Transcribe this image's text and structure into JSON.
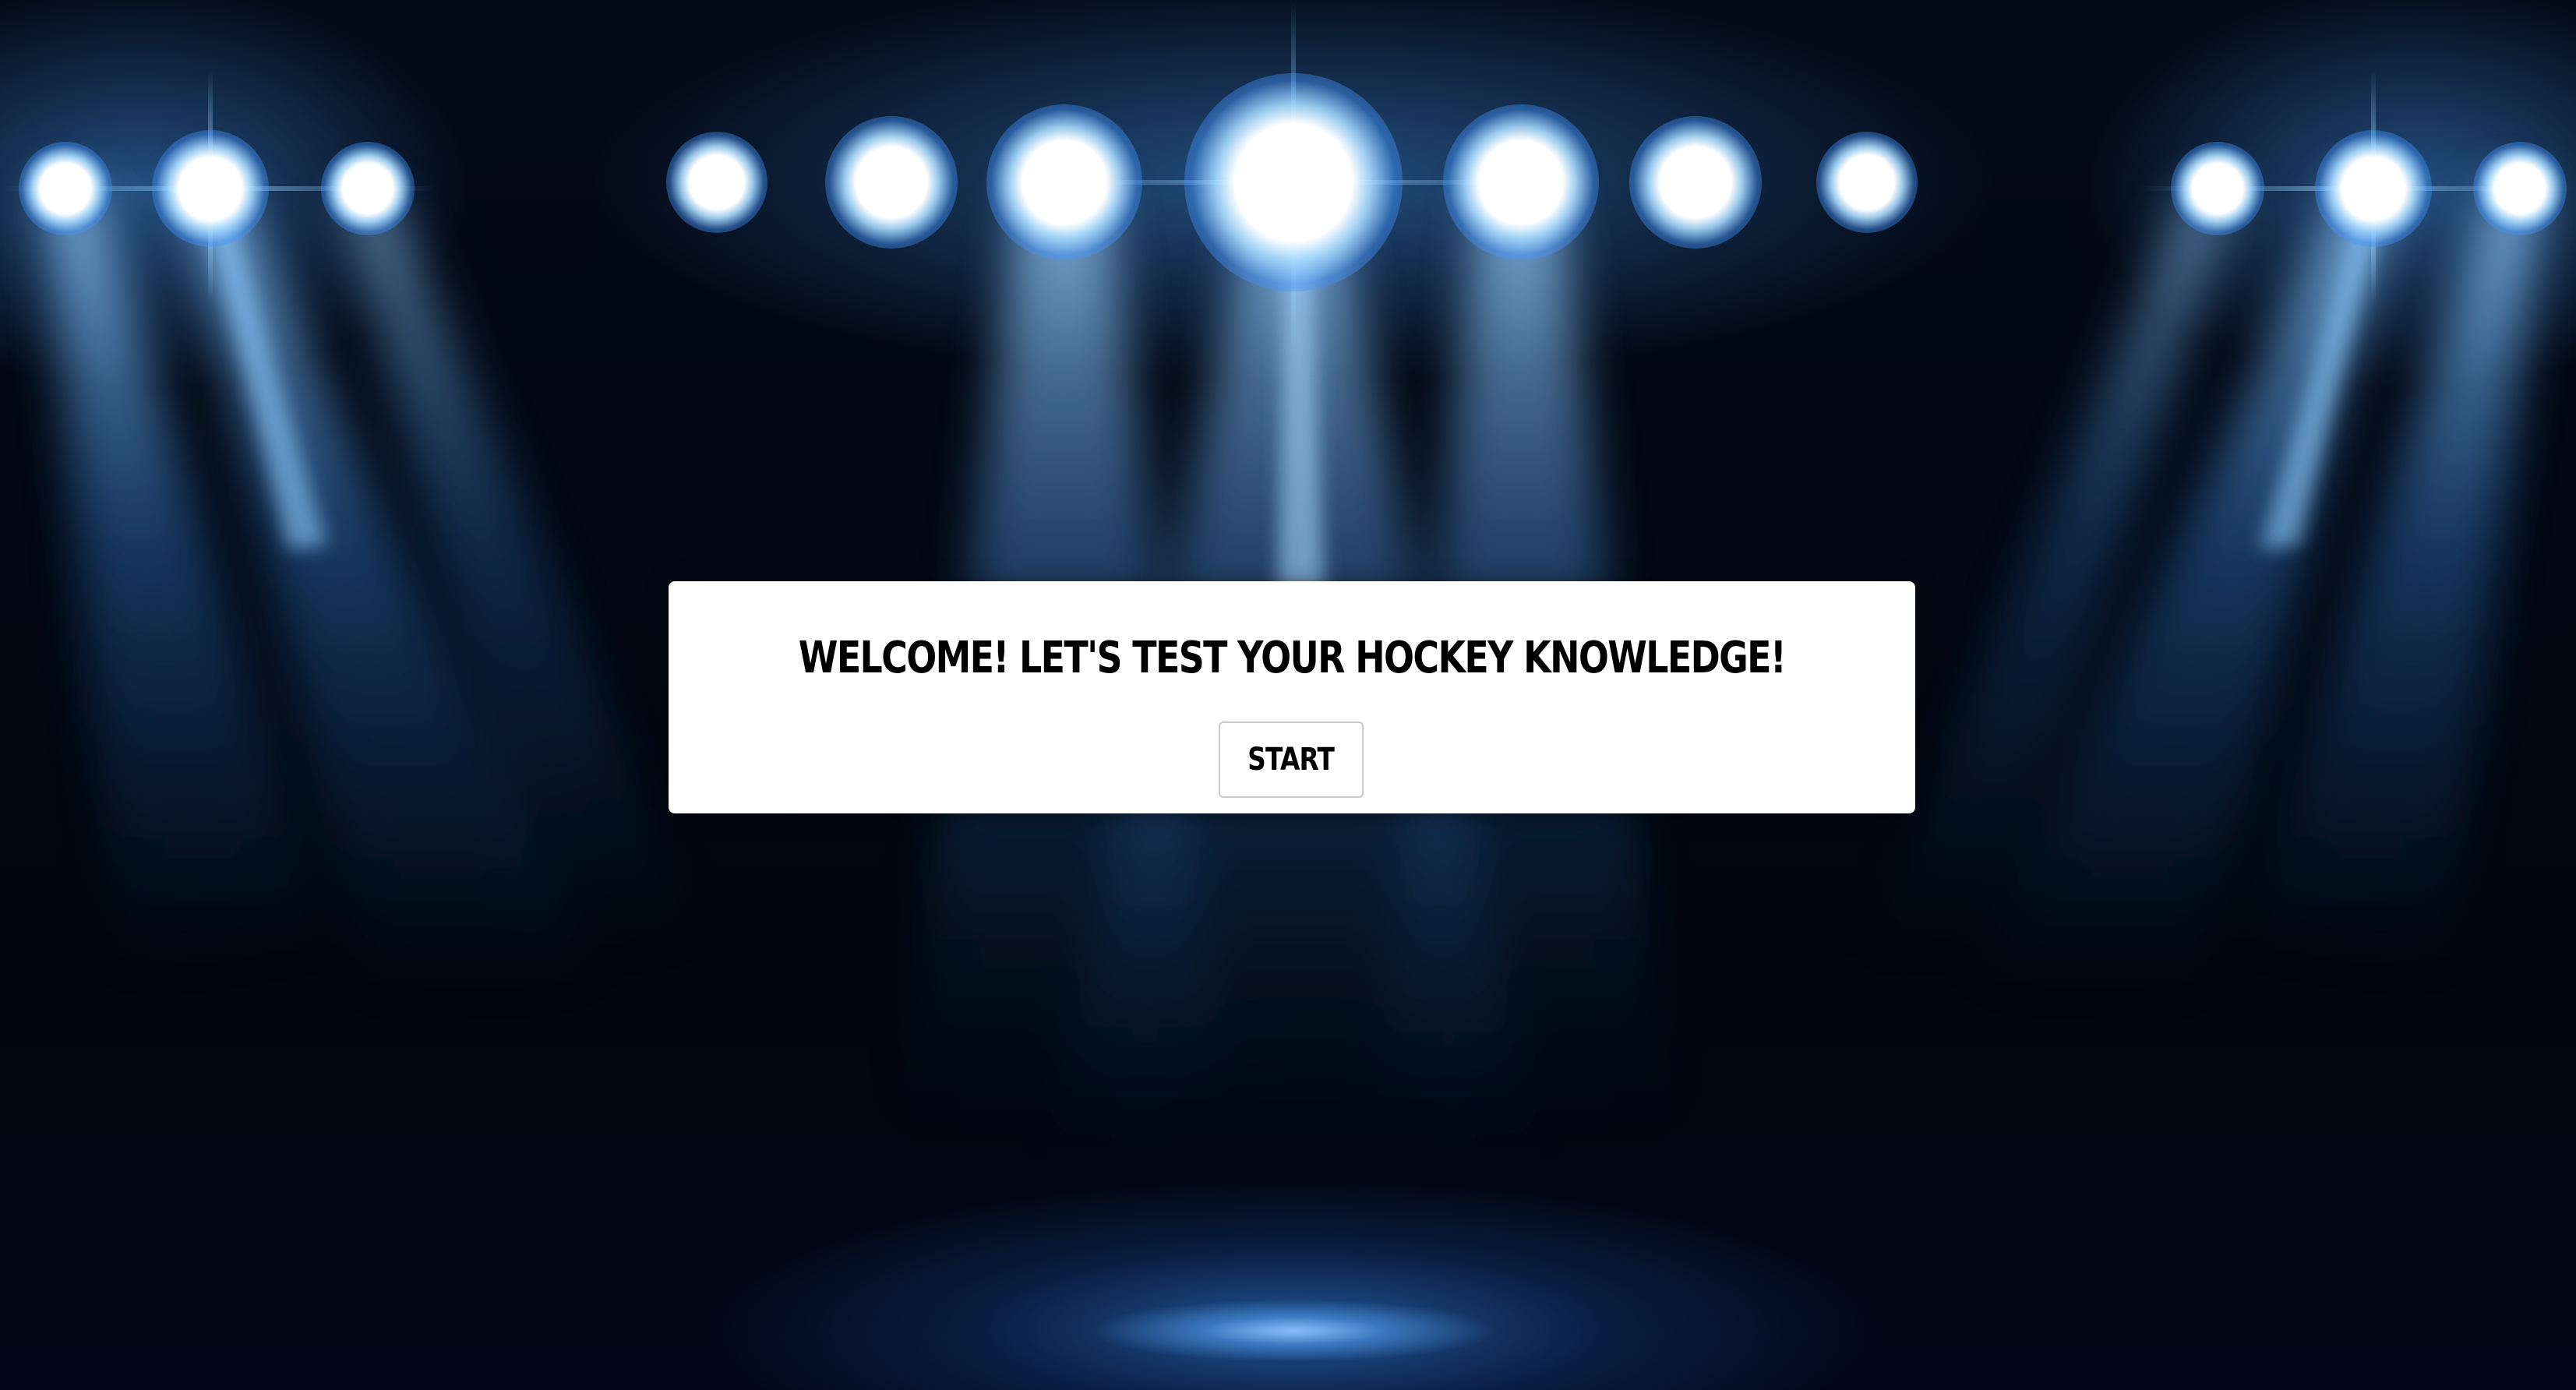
{
  "page": {
    "title": "Welcome! Let's Test Your Hockey Knowledge!",
    "start_label": "Start",
    "background_icon": "stadium-spotlights",
    "colors": {
      "background": "#01050d",
      "beam": "#3c96ff",
      "card": "#ffffff",
      "text": "#000000"
    }
  }
}
